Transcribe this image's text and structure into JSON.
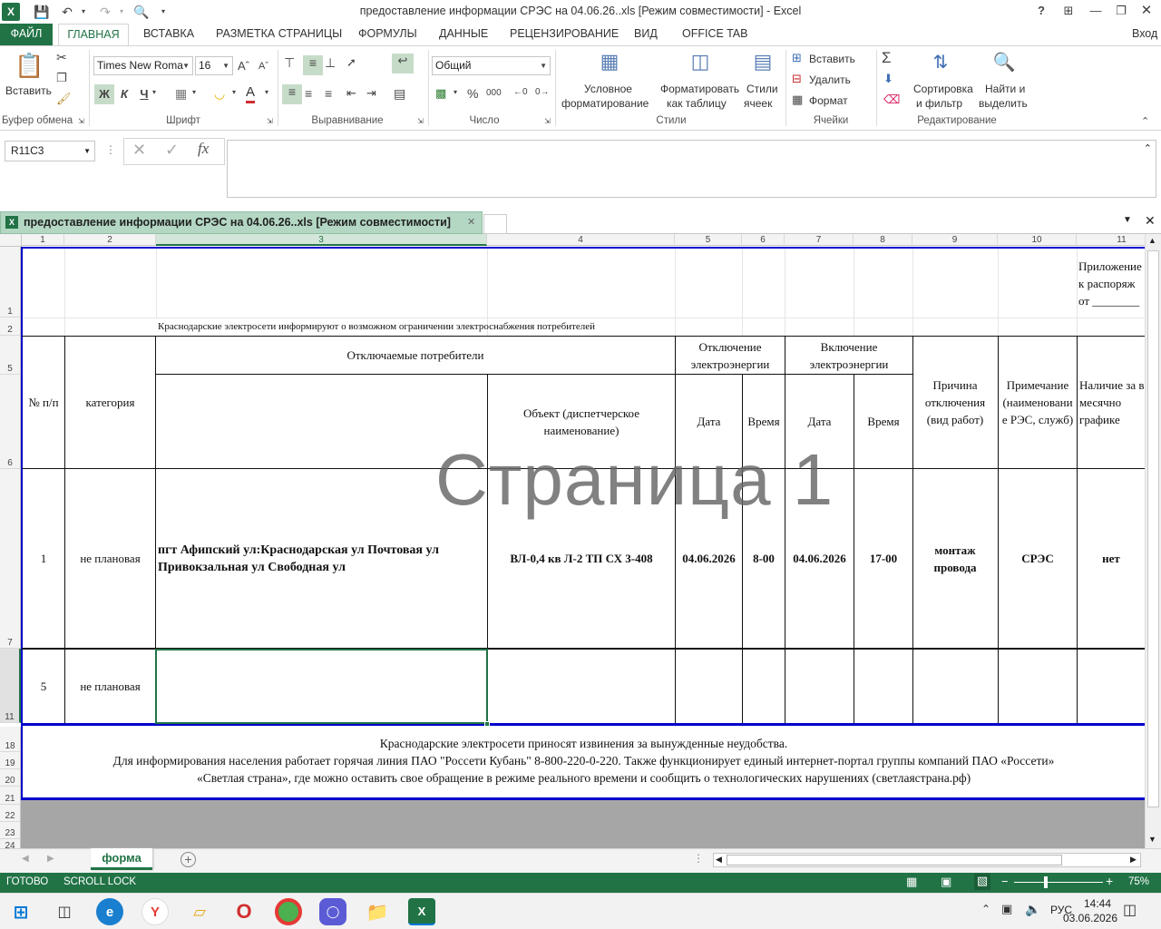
{
  "window": {
    "title": "предоставление информации СРЭС на 04.06.26..xls  [Режим совместимости] - Excel",
    "help": "?",
    "signin": "Вход"
  },
  "ribbon_tabs": [
    "ФАЙЛ",
    "ГЛАВНАЯ",
    "ВСТАВКА",
    "РАЗМЕТКА СТРАНИЦЫ",
    "ФОРМУЛЫ",
    "ДАННЫЕ",
    "РЕЦЕНЗИРОВАНИЕ",
    "ВИД",
    "OFFICE TAB"
  ],
  "ribbon": {
    "paste": "Вставить",
    "clipboard": "Буфер обмена",
    "font_name": "Times New Roma",
    "font_size": "16",
    "bold": "Ж",
    "italic": "К",
    "underline": "Ч",
    "font_group": "Шрифт",
    "align_group": "Выравнивание",
    "number_format": "Общий",
    "number_group": "Число",
    "cond_format_1": "Условное",
    "cond_format_2": "форматирование",
    "format_table_1": "Форматировать",
    "format_table_2": "как таблицу",
    "cell_styles_1": "Стили",
    "cell_styles_2": "ячеек",
    "styles_group": "Стили",
    "insert": "Вставить",
    "delete": "Удалить",
    "format": "Формат",
    "cells_group": "Ячейки",
    "sort_1": "Сортировка",
    "sort_2": "и фильтр",
    "find_1": "Найти и",
    "find_2": "выделить",
    "editing_group": "Редактирование",
    "percent": "%",
    "thousands": "000"
  },
  "formula_bar": {
    "name_box": "R11C3",
    "fx": "fx",
    "content": ""
  },
  "workbook_tab": "предоставление информации СРЭС на 04.06.26..xls  [Режим совместимости]",
  "columns": [
    "1",
    "2",
    "3",
    "4",
    "5",
    "6",
    "7",
    "8",
    "9",
    "10",
    "11"
  ],
  "rows": [
    "1",
    "2",
    "5",
    "6",
    "7",
    "11",
    "18",
    "19",
    "20",
    "21",
    "22",
    "23",
    "24"
  ],
  "sheet": {
    "appendix": [
      "Приложение",
      "к распоряж",
      "от ________"
    ],
    "intro": "Краснодарские электросети информируют о возможном ограничении электроснабжения потребителей",
    "h_num": "№ п/п",
    "h_category": "категория",
    "h_consumers": "Отключаемые потребители",
    "h_object": "Объект (диспетчерское наименование)",
    "h_off": "Отключение электроэнергии",
    "h_on": "Включение электроэнергии",
    "h_date": "Дата",
    "h_time": "Время",
    "h_reason": "Причина отключения (вид работ)",
    "h_note": "Примечание (наименовани е РЭС, служб)",
    "h_plan": "Наличие за в месячно графике",
    "r1": {
      "num": "1",
      "category": "не плановая",
      "consumers": "пгт Афипский ул:Краснодарская ул Почтовая ул Привокзальная ул Свободная ул",
      "object": "ВЛ-0,4 кв Л-2 ТП СХ 3-408",
      "off_date": "04.06.2026",
      "off_time": "8-00",
      "on_date": "04.06.2026",
      "on_time": "17-00",
      "reason": "монтаж провода",
      "note": "СРЭС",
      "plan": "нет"
    },
    "r2": {
      "num": "5",
      "category": "не плановая"
    },
    "footer": [
      "Краснодарские электросети приносят извинения за вынужденные неудобства.",
      "Для информирования населения работает горячая линия ПАО \"Россети Кубань\" 8-800-220-0-220. Также функционирует единый интернет-портал группы компаний ПАО «Россети»",
      "«Светлая страна», где можно оставить свое обращение в режиме реального времени и сообщить о технологических нарушениях (светлаястрана.рф)"
    ],
    "watermark": "Страница 1"
  },
  "sheet_tabs": [
    "форма"
  ],
  "status": {
    "ready": "ГОТОВО",
    "scroll_lock": "SCROLL LOCK",
    "zoom": "75%"
  },
  "taskbar": {
    "lang": "РУС",
    "time": "14:44",
    "date": "03.06.2026"
  },
  "colors": {
    "excel_green": "#217346",
    "selection": "#217346",
    "border_blue": "#0000cc"
  }
}
